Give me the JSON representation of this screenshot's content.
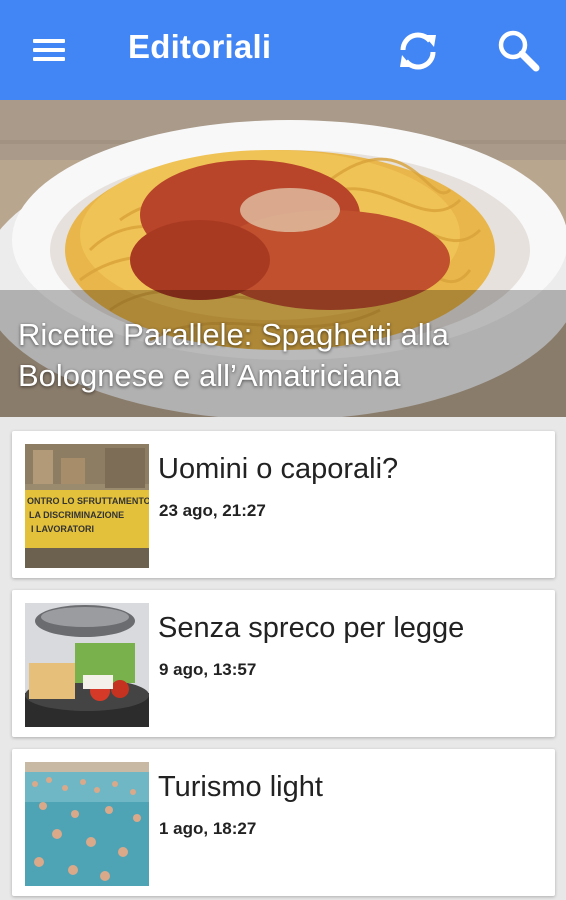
{
  "appbar": {
    "title": "Editoriali",
    "menu_icon": "menu-icon",
    "refresh_icon": "refresh-icon",
    "search_icon": "search-icon",
    "color": "#4285f4"
  },
  "featured": {
    "title": "Ricette Parallele: Spaghetti alla Bolognese e all’Amatriciana"
  },
  "articles": [
    {
      "title": "Uomini o caporali?",
      "date": "23 ago, 21:27"
    },
    {
      "title": "Senza spreco per legge",
      "date": "9 ago, 13:57"
    },
    {
      "title": "Turismo light",
      "date": "1 ago, 18:27"
    }
  ]
}
